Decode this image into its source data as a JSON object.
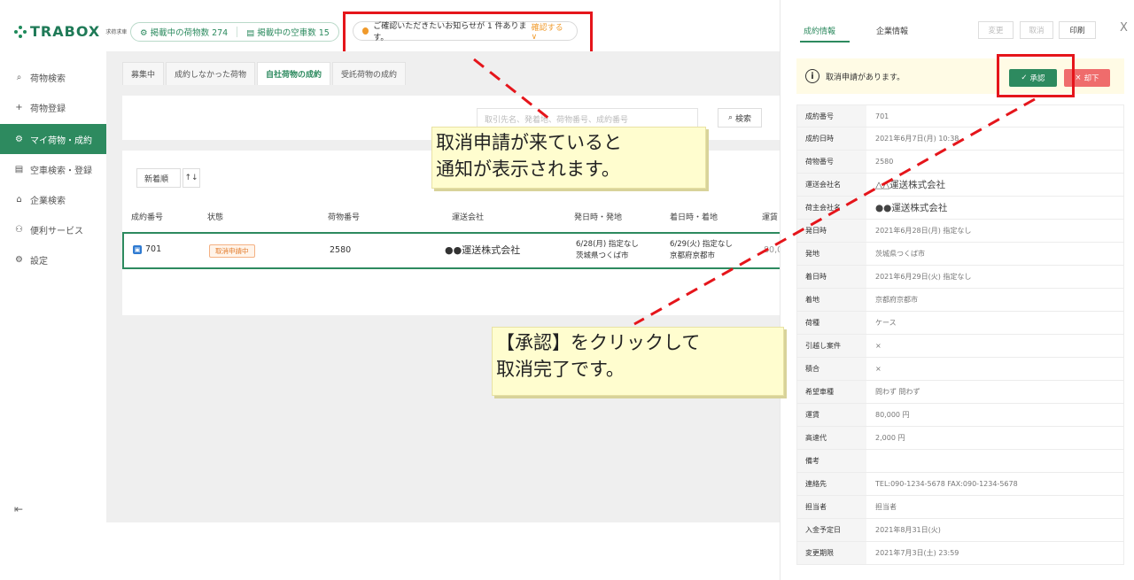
{
  "app": {
    "logo_text": "TRABOX",
    "logo_sub": "求荷求車",
    "stats": [
      {
        "label": "掲載中の荷物数 274"
      },
      {
        "label": "掲載中の空車数 15"
      }
    ],
    "notice": {
      "text": "ご確認いただきたいお知らせが 1 件あります。",
      "link": "確認する ∨"
    }
  },
  "sidebar": {
    "items": [
      {
        "icon": "search-icon",
        "glyph": "⌕",
        "label": "荷物検索"
      },
      {
        "icon": "plus-icon",
        "glyph": "+",
        "label": "荷物登録"
      },
      {
        "icon": "gear-icon",
        "glyph": "⚙",
        "label": "マイ荷物・成約"
      },
      {
        "icon": "truck-icon",
        "glyph": "▤",
        "label": "空車検索・登録"
      },
      {
        "icon": "building-icon",
        "glyph": "⌂",
        "label": "企業検索"
      },
      {
        "icon": "service-icon",
        "glyph": "⚇",
        "label": "便利サービス"
      },
      {
        "icon": "settings-icon",
        "glyph": "⚙",
        "label": "設定"
      }
    ],
    "collapse_glyph": "⇤"
  },
  "main": {
    "tabs": [
      "募集中",
      "成約しなかった荷物",
      "自社荷物の成約",
      "受託荷物の成約"
    ],
    "active_tab": 2,
    "search_placeholder": "取引先名、発着地、荷物番号、成約番号",
    "search_button": "検索",
    "sort_label": "新着順",
    "sort_toggle": "↑↓",
    "columns": [
      "成約番号",
      "状態",
      "荷物番号",
      "運送会社",
      "発日時・発地",
      "着日時・着地",
      "運賃"
    ],
    "row": {
      "id": "701",
      "status": "取消申請中",
      "cargo_no": "2580",
      "carrier": "●●運送株式会社",
      "dep_line1": "6/28(月) 指定なし",
      "dep_line2": "茨城県つくば市",
      "arr_line1": "6/29(火) 指定なし",
      "arr_line2": "京都府京都市",
      "fare": "80,0"
    }
  },
  "detail": {
    "tabs": [
      "成約情報",
      "企業情報"
    ],
    "buttons": {
      "change": "変更",
      "cancel": "取消",
      "print": "印刷",
      "close": "X"
    },
    "alert": {
      "text": "取消申請があります。",
      "approve": "承認",
      "reject": "却下"
    },
    "rows": [
      {
        "label": "成約番号",
        "value": "701"
      },
      {
        "label": "成約日時",
        "value": "2021年6月7日(月) 10:38"
      },
      {
        "label": "荷物番号",
        "value": "2580"
      },
      {
        "label": "運送会社名",
        "value": "△△運送株式会社"
      },
      {
        "label": "荷主会社名",
        "value": "●●運送株式会社"
      },
      {
        "label": "発日時",
        "value": "2021年6月28日(月) 指定なし"
      },
      {
        "label": "発地",
        "value": "茨城県つくば市"
      },
      {
        "label": "着日時",
        "value": "2021年6月29日(火) 指定なし"
      },
      {
        "label": "着地",
        "value": "京都府京都市"
      },
      {
        "label": "荷種",
        "value": "ケース"
      },
      {
        "label": "引越し案件",
        "value": "×"
      },
      {
        "label": "積合",
        "value": "×"
      },
      {
        "label": "希望車種",
        "value": "問わず 問わず"
      },
      {
        "label": "運賃",
        "value": "80,000 円"
      },
      {
        "label": "高速代",
        "value": "2,000 円"
      },
      {
        "label": "備考",
        "value": ""
      },
      {
        "label": "連絡先",
        "value": "TEL:090-1234-5678 FAX:090-1234-5678"
      },
      {
        "label": "担当者",
        "value": "担当者"
      },
      {
        "label": "入金予定日",
        "value": "2021年8月31日(火)"
      },
      {
        "label": "変更期限",
        "value": "2021年7月3日(土) 23:59"
      }
    ]
  },
  "callouts": {
    "first": [
      "取消申請が来ていると",
      "通知が表示されます。"
    ],
    "second": [
      "【承認】をクリックして",
      "取消完了です。"
    ]
  },
  "colors": {
    "brand": "#2d8a5f",
    "highlight": "#e5151b",
    "warning": "#f09a2b",
    "reject": "#ef6c6c"
  }
}
